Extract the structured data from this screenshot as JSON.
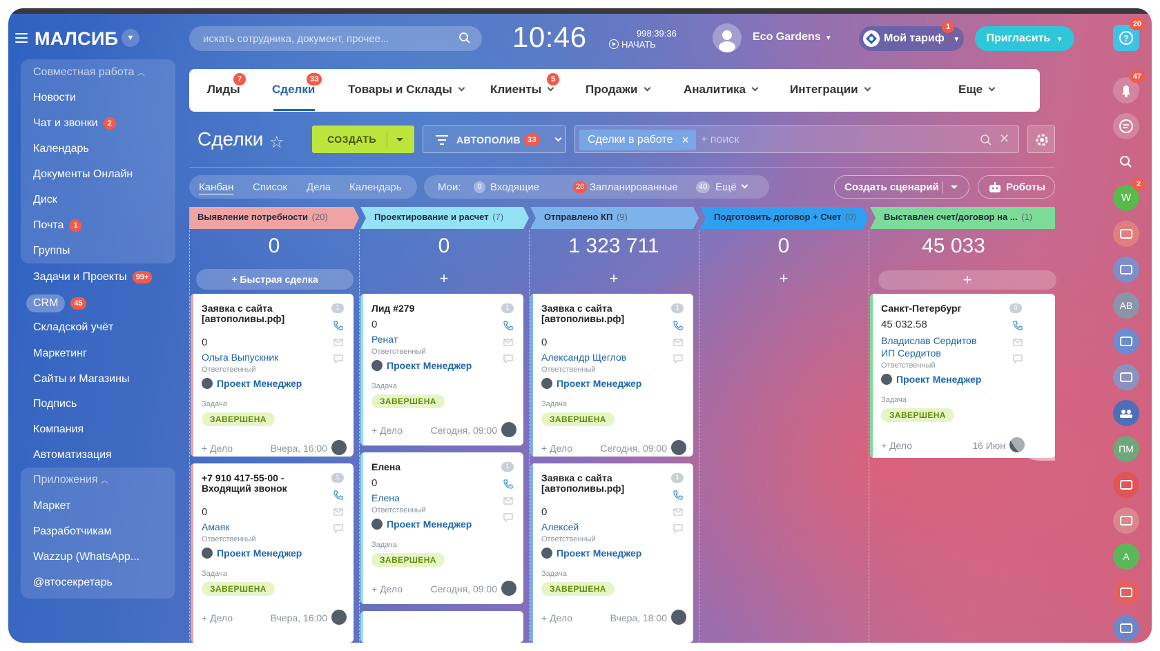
{
  "topbar": {
    "logo": "МАЛСИБ",
    "search_placeholder": "искать сотрудника, документ, прочее...",
    "clock": "10:46",
    "timer": "998:39:36",
    "timer_action": "НАЧАТЬ",
    "company": "Eco Gardens",
    "tariff": "Мой тариф",
    "tariff_badge": "1",
    "invite": "Пригласить",
    "help_badge": "20"
  },
  "sidebar": {
    "group1": "Совместная работа",
    "items": [
      {
        "label": "Новости",
        "badge": ""
      },
      {
        "label": "Чат и звонки",
        "badge": "2"
      },
      {
        "label": "Календарь",
        "badge": ""
      },
      {
        "label": "Документы Онлайн",
        "badge": ""
      },
      {
        "label": "Диск",
        "badge": ""
      },
      {
        "label": "Почта",
        "badge": "1"
      },
      {
        "label": "Группы",
        "badge": ""
      },
      {
        "label": "Задачи и Проекты",
        "badge": "99+"
      },
      {
        "label": "CRM",
        "badge": "45"
      },
      {
        "label": "Складской учёт",
        "badge": ""
      },
      {
        "label": "Маркетинг",
        "badge": ""
      },
      {
        "label": "Сайты и Магазины",
        "badge": ""
      },
      {
        "label": "Подпись",
        "badge": ""
      },
      {
        "label": "Компания",
        "badge": ""
      },
      {
        "label": "Автоматизация",
        "badge": ""
      }
    ],
    "group2": "Приложения",
    "apps": [
      "Маркет",
      "Разработчикам",
      "Wazzup (WhatsApp...",
      "@втосекретарь"
    ]
  },
  "rightbar": {
    "bell_badge": "47",
    "w_label": "W",
    "w_badge": "2",
    "ab": "AB",
    "pm": "ПМ",
    "a": "А"
  },
  "nav": {
    "items": [
      {
        "label": "Лиды",
        "badge": "7"
      },
      {
        "label": "Сделки",
        "badge": "33"
      },
      {
        "label": "Товары и Склады"
      },
      {
        "label": "Клиенты",
        "badge": "5"
      },
      {
        "label": "Продажи"
      },
      {
        "label": "Аналитика"
      },
      {
        "label": "Интеграции"
      },
      {
        "label": "Еще"
      }
    ]
  },
  "toolbar": {
    "title": "Сделки",
    "create": "СОЗДАТЬ",
    "filter": "АВТОПОЛИВ",
    "filter_count": "33",
    "chip": "Сделки в работе",
    "search_placeholder": "+ поиск"
  },
  "views": {
    "tabs": [
      "Канбан",
      "Список",
      "Дела",
      "Календарь"
    ],
    "mine_label": "Мои:",
    "incoming_count": "0",
    "incoming": "Входящие",
    "planned_count": "20",
    "planned": "Запланированные",
    "more_count": "40",
    "more": "Ещё",
    "scenario": "Создать сценарий",
    "robots": "Роботы"
  },
  "columns": [
    {
      "title": "Выявление потребности",
      "count": "(20)",
      "sum": "0",
      "color": "#f0a3a3"
    },
    {
      "title": "Проектирование и расчет",
      "count": "(7)",
      "sum": "0",
      "color": "#94e1f5"
    },
    {
      "title": "Отправлено КП",
      "count": "(9)",
      "sum": "1 323 711",
      "color": "#7cb3ea"
    },
    {
      "title": "Подготовить договор + Счет",
      "count": "(0)",
      "sum": "0",
      "color": "#2f9ff0"
    },
    {
      "title": "Выставлен счет/договор на ...",
      "count": "(1)",
      "sum": "45 033",
      "color": "#7ddb9a"
    }
  ],
  "quick_deal": "+ Быстрая сделка",
  "cards": {
    "c1a": {
      "title": "Заявка с сайта [автополивы.рф]",
      "num": "1",
      "amount": "0",
      "person": "Ольга Выпускник",
      "resp": "Ответственный",
      "mgr": "Проект Менеджер",
      "task": "Задача",
      "status": "ЗАВЕРШЕНА",
      "add": "+ Дело",
      "date": "Вчера, 16:00"
    },
    "c1b": {
      "title": "+7 910 417-55-00 - Входящий звонок",
      "num": "1",
      "amount": "0",
      "person": "Амаяк",
      "resp": "Ответственный",
      "mgr": "Проект Менеджер",
      "task": "Задача",
      "status": "ЗАВЕРШЕНА",
      "add": "+ Дело",
      "date": "Вчера, 16:00"
    },
    "c2a": {
      "title": "Лид #279",
      "num": "1",
      "amount": "0",
      "person": "Ренат",
      "resp": "Ответственный",
      "mgr": "Проект Менеджер",
      "task": "Задача",
      "status": "ЗАВЕРШЕНА",
      "add": "+ Дело",
      "date": "Сегодня, 09:00"
    },
    "c2b": {
      "title": "Елена",
      "num": "1",
      "amount": "0",
      "person": "Елена",
      "resp": "Ответственный",
      "mgr": "Проект Менеджер",
      "task": "Задача",
      "status": "ЗАВЕРШЕНА",
      "add": "+ Дело",
      "date": "Сегодня, 09:00"
    },
    "c3a": {
      "title": "Заявка с сайта [автополивы.рф]",
      "num": "1",
      "amount": "0",
      "person": "Александр Щеглов",
      "resp": "Ответственный",
      "mgr": "Проект Менеджер",
      "task": "Задача",
      "status": "ЗАВЕРШЕНА",
      "add": "+ Дело",
      "date": "Сегодня, 09:00"
    },
    "c3b": {
      "title": "Заявка с сайта [автополивы.рф]",
      "num": "1",
      "amount": "0",
      "person": "Алексей",
      "resp": "Ответственный",
      "mgr": "Проект Менеджер",
      "task": "Задача",
      "status": "ЗАВЕРШЕНА",
      "add": "+ Дело",
      "date": "Вчера, 18:00"
    },
    "c5a": {
      "title": "Санкт-Петербург",
      "num": "0",
      "amount": "45 032.58",
      "person": "Владислав Сердитов",
      "person2": "ИП Сердитов",
      "resp": "Ответственный",
      "mgr": "Проект Менеджер",
      "task": "Задача",
      "status": "ЗАВЕРШЕНА",
      "add": "+ Дело",
      "date": "16 Июн"
    }
  }
}
